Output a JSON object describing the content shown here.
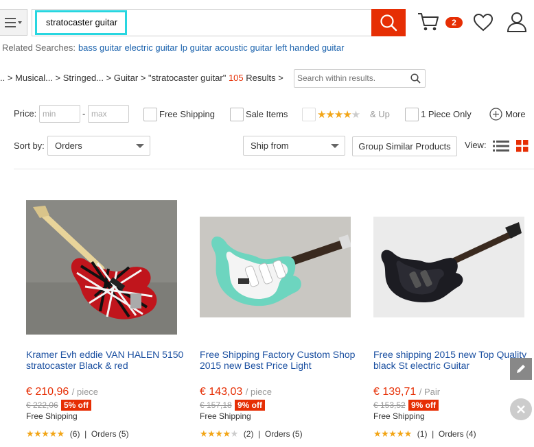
{
  "header": {
    "search_value": "stratocaster guitar",
    "cart_count": "2"
  },
  "related": {
    "label": "Related Searches:",
    "items": [
      "bass guitar",
      "electric guitar",
      "lp guitar",
      "acoustic guitar",
      "left handed guitar"
    ]
  },
  "breadcrumb": {
    "items": [
      ".. > Musical... > Stringed... > Guitar > ",
      "\"stratocaster guitar\""
    ],
    "count": "105",
    "results_label": "Results >",
    "within_placeholder": "Search within results."
  },
  "filters": {
    "price_label": "Price:",
    "min_placeholder": "min",
    "dash": "-",
    "max_placeholder": "max",
    "free_shipping": "Free Shipping",
    "sale_items": "Sale Items",
    "rating_up": "& Up",
    "one_piece": "1 Piece Only",
    "more": "More",
    "sort_label": "Sort by:",
    "sort_value": "Orders",
    "ship_from": "Ship from",
    "group_similar": "Group Similar Products",
    "view_label": "View:"
  },
  "products": [
    {
      "title": "Kramer Evh eddie VAN HALEN 5150 stratocaster Black & red",
      "price": "€ 210,96",
      "unit": "/ piece",
      "old_price": "€ 222,06",
      "discount": "5% off",
      "shipping": "Free Shipping",
      "rating": 5,
      "reviews": "(6)",
      "orders": "Orders (5)"
    },
    {
      "title": "Free Shipping Factory Custom Shop 2015 new Best Price Light",
      "price": "€ 143,03",
      "unit": "/ piece",
      "old_price": "€ 157,18",
      "discount": "9% off",
      "shipping": "Free Shipping",
      "rating": 4,
      "reviews": "(2)",
      "orders": "Orders (5)"
    },
    {
      "title": "Free shipping 2015 new Top Quality black St electric Guitar",
      "price": "€ 139,71",
      "unit": "/ Pair",
      "old_price": "€ 153,52",
      "discount": "9% off",
      "shipping": "Free Shipping",
      "rating": 5,
      "reviews": "(1)",
      "orders": "Orders (4)"
    }
  ],
  "colors": {
    "accent": "#e62e04",
    "link": "#1a62ad",
    "highlight": "#28d6e0",
    "star": "#f2a516"
  }
}
